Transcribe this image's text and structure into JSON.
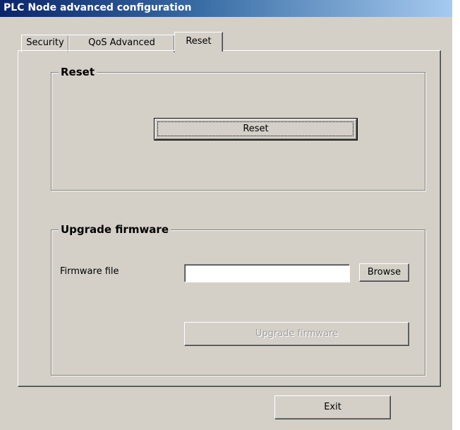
{
  "window": {
    "title": "PLC Node advanced configuration"
  },
  "tabs": [
    {
      "label": "Security",
      "active": false
    },
    {
      "label": "QoS Advanced",
      "active": false
    },
    {
      "label": "Reset",
      "active": true
    }
  ],
  "reset_group": {
    "title": "Reset",
    "reset_button_label": "Reset"
  },
  "upgrade_group": {
    "title": "Upgrade firmware",
    "firmware_file_label": "Firmware file",
    "firmware_file_value": "",
    "browse_button_label": "Browse",
    "upgrade_button_label": "Upgrade firmware",
    "upgrade_button_enabled": false
  },
  "footer": {
    "exit_button_label": "Exit"
  }
}
